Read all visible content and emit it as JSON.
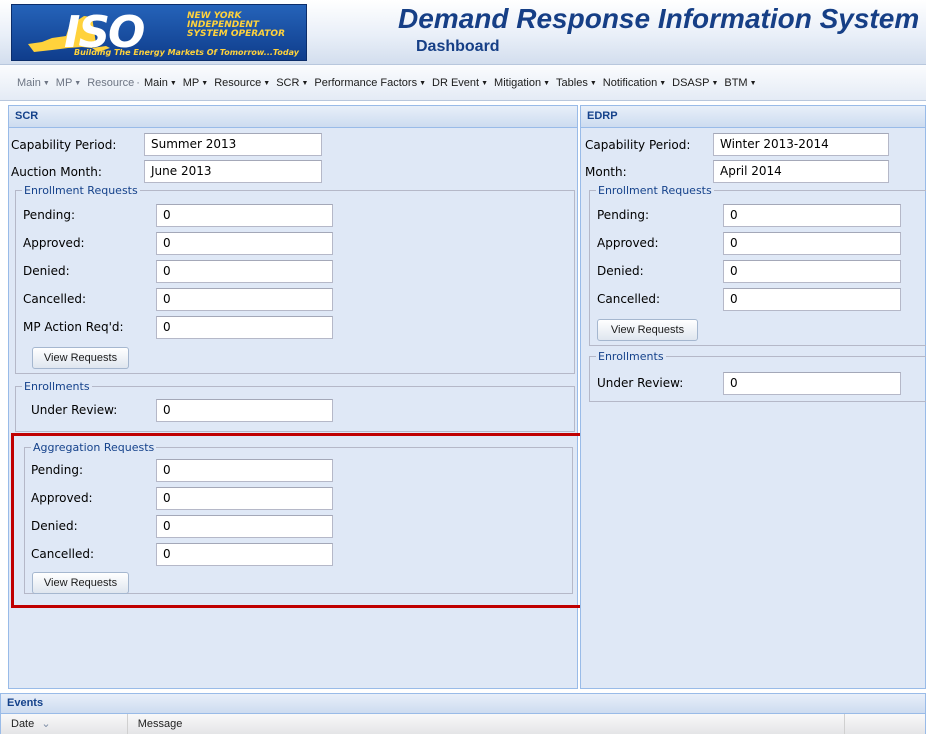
{
  "header": {
    "logo_text": "ISO",
    "logo_org": "NEW YORK INDEPENDENT SYSTEM OPERATOR",
    "logo_tagline": "Building The Energy Markets Of Tomorrow...Today",
    "title": "Demand Response Information System",
    "subtitle": "Dashboard",
    "colors": {
      "title": "#163f86",
      "logo_bg": "#1d4fa3",
      "logo_accent": "#ffd23c"
    }
  },
  "menu": {
    "ghost_items": [
      "Main",
      "MP",
      "Resource"
    ],
    "items": [
      "Main",
      "MP",
      "Resource",
      "SCR",
      "Performance Factors",
      "DR Event",
      "Mitigation",
      "Tables",
      "Notification",
      "DSASP",
      "BTM"
    ],
    "arrow_icon": "chevron-down-icon"
  },
  "scr": {
    "title": "SCR",
    "capability_period_label": "Capability Period:",
    "capability_period_value": "Summer 2013",
    "auction_month_label": "Auction Month:",
    "auction_month_value": "June 2013",
    "enrollment_requests": {
      "legend": "Enrollment Requests",
      "pending_label": "Pending:",
      "pending_value": "0",
      "approved_label": "Approved:",
      "approved_value": "0",
      "denied_label": "Denied:",
      "denied_value": "0",
      "cancelled_label": "Cancelled:",
      "cancelled_value": "0",
      "mp_action_label": "MP Action Req'd:",
      "mp_action_value": "0",
      "view_button": "View Requests"
    },
    "enrollments": {
      "legend": "Enrollments",
      "under_review_label": "Under Review:",
      "under_review_value": "0"
    },
    "aggregation_requests": {
      "legend": "Aggregation Requests",
      "pending_label": "Pending:",
      "pending_value": "0",
      "approved_label": "Approved:",
      "approved_value": "0",
      "denied_label": "Denied:",
      "denied_value": "0",
      "cancelled_label": "Cancelled:",
      "cancelled_value": "0",
      "view_button": "View Requests"
    }
  },
  "edrp": {
    "title": "EDRP",
    "capability_period_label": "Capability Period:",
    "capability_period_value": "Winter 2013-2014",
    "month_label": "Month:",
    "month_value": "April 2014",
    "enrollment_requests": {
      "legend": "Enrollment Requests",
      "pending_label": "Pending:",
      "pending_value": "0",
      "approved_label": "Approved:",
      "approved_value": "0",
      "denied_label": "Denied:",
      "denied_value": "0",
      "cancelled_label": "Cancelled:",
      "cancelled_value": "0",
      "view_button": "View Requests"
    },
    "enrollments": {
      "legend": "Enrollments",
      "under_review_label": "Under Review:",
      "under_review_value": "0"
    }
  },
  "events": {
    "title": "Events",
    "columns": [
      "Date",
      "Message"
    ],
    "sort_icon": "sort-icon"
  },
  "annotation": {
    "highlight_color": "#c00000"
  }
}
